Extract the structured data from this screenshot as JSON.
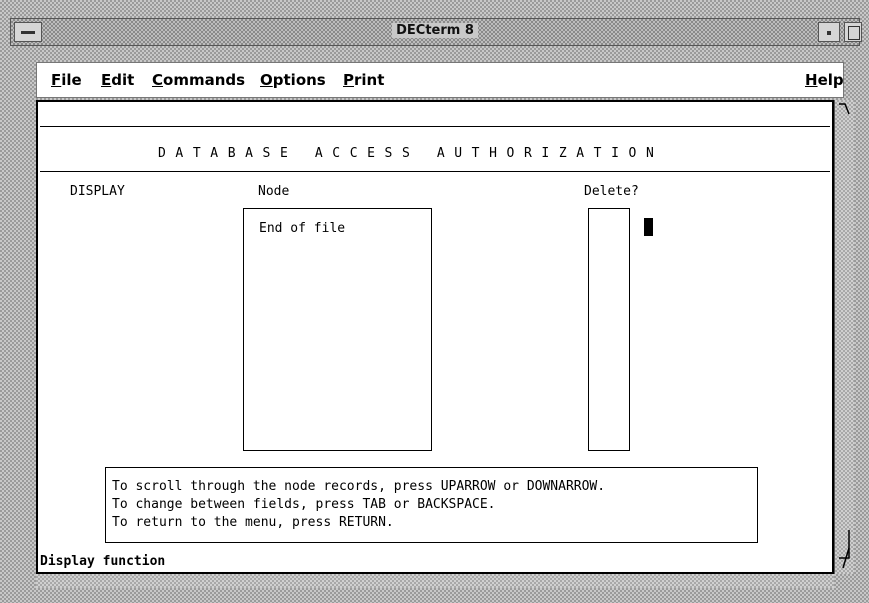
{
  "window": {
    "title": "DECterm 8"
  },
  "menubar": {
    "items": [
      {
        "label": "File",
        "mnemonic": "F"
      },
      {
        "label": "Edit",
        "mnemonic": "E"
      },
      {
        "label": "Commands",
        "mnemonic": "C"
      },
      {
        "label": "Options",
        "mnemonic": "O"
      },
      {
        "label": "Print",
        "mnemonic": "P"
      }
    ],
    "help": {
      "label": "Help",
      "mnemonic": "H"
    }
  },
  "screen": {
    "heading": "DATABASE ACCESS AUTHORIZATION",
    "mode_label": "DISPLAY",
    "node_header": "Node",
    "delete_header": "Delete?",
    "node_list": [
      "End of file"
    ],
    "delete_list": [
      ""
    ],
    "instructions": [
      "To scroll through the node records, press UPARROW or DOWNARROW.",
      "To change between fields, press TAB or BACKSPACE.",
      "To return to the menu, press RETURN."
    ],
    "status": "Display function"
  }
}
